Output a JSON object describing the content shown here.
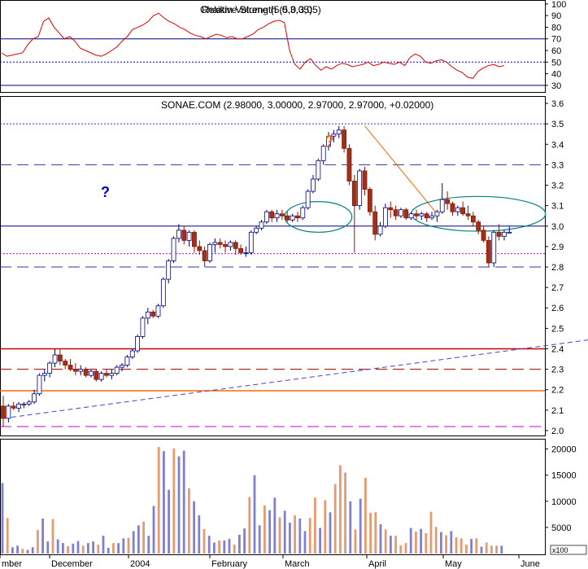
{
  "chart_data": [
    {
      "panel": "rsi",
      "type": "line",
      "title": "Relative Strength (5,0.3,05)",
      "title_overlay": "Chaikin Volume (5,0.3,05)",
      "y_ticks": [
        30,
        40,
        50,
        60,
        70,
        80,
        90,
        100
      ],
      "ylim": [
        25,
        102
      ],
      "reference_lines": [
        {
          "value": 70,
          "style": "solid",
          "color": "#000080"
        },
        {
          "value": 50,
          "style": "dotted",
          "color": "#0000cc"
        },
        {
          "value": 30,
          "style": "solid",
          "color": "#000080"
        }
      ],
      "series": [
        {
          "color": "#dd0000",
          "values": [
            58,
            55,
            56,
            57,
            58,
            65,
            70,
            72,
            85,
            88,
            80,
            75,
            70,
            72,
            68,
            62,
            60,
            58,
            56,
            55,
            57,
            60,
            63,
            68,
            72,
            78,
            80,
            82,
            85,
            90,
            92,
            88,
            85,
            83,
            80,
            78,
            75,
            73,
            72,
            70,
            72,
            74,
            73,
            71,
            72,
            70,
            70,
            72,
            74,
            78,
            80,
            83,
            85,
            86,
            84,
            60,
            48,
            44,
            50,
            53,
            47,
            43,
            46,
            44,
            47,
            49,
            48,
            46,
            47,
            48,
            50,
            47,
            48,
            50,
            49,
            48,
            50,
            47,
            54,
            57,
            55,
            50,
            49,
            51,
            52,
            50,
            46,
            43,
            41,
            37,
            36,
            42,
            45,
            47,
            48,
            46,
            47
          ]
        }
      ]
    },
    {
      "panel": "price",
      "type": "candlestick",
      "title": "SONAE.COM (2.98000, 3.00000, 2.97000, 2.97000, +0.02000)",
      "y_ticks": [
        2.0,
        2.1,
        2.2,
        2.3,
        2.4,
        2.5,
        2.6,
        2.7,
        2.8,
        2.9,
        3.0,
        3.1,
        3.2,
        3.3,
        3.4,
        3.5,
        3.6
      ],
      "ylim": [
        1.98,
        3.62
      ],
      "x_labels": [
        "mber",
        "December",
        "2004",
        "February",
        "March",
        "April",
        "May",
        "June"
      ],
      "annotations": [
        {
          "text": "?",
          "color": "#0000cc"
        },
        {
          "text": "?",
          "color": "#ff6600"
        }
      ],
      "horizontal_lines": [
        {
          "value": 3.5,
          "style": "dotted",
          "color": "#3333cc"
        },
        {
          "value": 3.3,
          "style": "dashed",
          "color": "#3333aa"
        },
        {
          "value": 3.0,
          "style": "solid",
          "color": "#000080"
        },
        {
          "value": 2.865,
          "style": "dotted",
          "color": "#cc00cc"
        },
        {
          "value": 2.8,
          "style": "dashed",
          "color": "#3333aa"
        },
        {
          "value": 2.4,
          "style": "solid",
          "color": "#cc0000"
        },
        {
          "value": 2.3,
          "style": "dashed",
          "color": "#990000"
        },
        {
          "value": 2.195,
          "style": "solid",
          "color": "#ff6600"
        },
        {
          "value": 2.02,
          "style": "dashed",
          "color": "#cc00cc"
        }
      ],
      "trendlines": [
        {
          "from": [
            0,
            2.06
          ],
          "to": [
            130,
            2.5
          ],
          "color": "#4444cc",
          "style": "dashed"
        },
        {
          "from": [
            70,
            3.49
          ],
          "to": [
            84,
            3.06
          ],
          "color": "#ff6600",
          "style": "solid"
        }
      ],
      "ellipses": [
        {
          "center": [
            61,
            3.045
          ],
          "rx_bars": 6.5,
          "ry": 0.075,
          "color": "#008080"
        },
        {
          "center": [
            92,
            3.06
          ],
          "rx_bars": 13,
          "ry": 0.085,
          "color": "#008080"
        }
      ],
      "series": [
        {
          "name": "SONAE.COM",
          "ohlc": [
            [
              2.12,
              2.17,
              2.02,
              2.06
            ],
            [
              2.06,
              2.13,
              2.04,
              2.12
            ],
            [
              2.12,
              2.14,
              2.1,
              2.11
            ],
            [
              2.11,
              2.14,
              2.09,
              2.13
            ],
            [
              2.13,
              2.14,
              2.11,
              2.13
            ],
            [
              2.13,
              2.15,
              2.12,
              2.14
            ],
            [
              2.14,
              2.2,
              2.13,
              2.18
            ],
            [
              2.18,
              2.28,
              2.17,
              2.27
            ],
            [
              2.27,
              2.3,
              2.24,
              2.28
            ],
            [
              2.28,
              2.34,
              2.26,
              2.33
            ],
            [
              2.33,
              2.4,
              2.31,
              2.37
            ],
            [
              2.37,
              2.4,
              2.32,
              2.34
            ],
            [
              2.34,
              2.35,
              2.3,
              2.32
            ],
            [
              2.32,
              2.35,
              2.29,
              2.3
            ],
            [
              2.3,
              2.33,
              2.27,
              2.29
            ],
            [
              2.29,
              2.32,
              2.27,
              2.3
            ],
            [
              2.3,
              2.31,
              2.26,
              2.27
            ],
            [
              2.27,
              2.3,
              2.26,
              2.29
            ],
            [
              2.29,
              2.3,
              2.24,
              2.25
            ],
            [
              2.25,
              2.29,
              2.24,
              2.28
            ],
            [
              2.28,
              2.3,
              2.26,
              2.27
            ],
            [
              2.27,
              2.3,
              2.25,
              2.28
            ],
            [
              2.28,
              2.32,
              2.27,
              2.31
            ],
            [
              2.31,
              2.33,
              2.29,
              2.32
            ],
            [
              2.32,
              2.37,
              2.31,
              2.36
            ],
            [
              2.36,
              2.4,
              2.35,
              2.39
            ],
            [
              2.39,
              2.47,
              2.38,
              2.46
            ],
            [
              2.46,
              2.56,
              2.45,
              2.55
            ],
            [
              2.55,
              2.6,
              2.52,
              2.58
            ],
            [
              2.58,
              2.59,
              2.55,
              2.56
            ],
            [
              2.56,
              2.62,
              2.55,
              2.61
            ],
            [
              2.61,
              2.75,
              2.6,
              2.74
            ],
            [
              2.74,
              2.84,
              2.72,
              2.83
            ],
            [
              2.83,
              2.95,
              2.82,
              2.94
            ],
            [
              2.94,
              3.01,
              2.92,
              2.98
            ],
            [
              2.98,
              3.0,
              2.91,
              2.93
            ],
            [
              2.93,
              2.98,
              2.9,
              2.97
            ],
            [
              2.97,
              2.98,
              2.87,
              2.9
            ],
            [
              2.9,
              2.93,
              2.86,
              2.88
            ],
            [
              2.88,
              2.9,
              2.8,
              2.83
            ],
            [
              2.83,
              2.92,
              2.82,
              2.91
            ],
            [
              2.91,
              2.94,
              2.87,
              2.92
            ],
            [
              2.92,
              2.94,
              2.89,
              2.91
            ],
            [
              2.91,
              2.93,
              2.87,
              2.9
            ],
            [
              2.9,
              2.93,
              2.88,
              2.92
            ],
            [
              2.92,
              2.93,
              2.86,
              2.89
            ],
            [
              2.89,
              2.91,
              2.86,
              2.87
            ],
            [
              2.87,
              2.9,
              2.85,
              2.87
            ],
            [
              2.87,
              2.98,
              2.86,
              2.97
            ],
            [
              2.97,
              3.0,
              2.96,
              2.99
            ],
            [
              2.99,
              3.03,
              2.98,
              3.02
            ],
            [
              3.02,
              3.08,
              3.01,
              3.07
            ],
            [
              3.07,
              3.08,
              3.02,
              3.04
            ],
            [
              3.04,
              3.08,
              3.02,
              3.06
            ],
            [
              3.06,
              3.08,
              3.03,
              3.05
            ],
            [
              3.05,
              3.07,
              3.02,
              3.03
            ],
            [
              3.03,
              3.06,
              3.02,
              3.05
            ],
            [
              3.05,
              3.07,
              3.02,
              3.04
            ],
            [
              3.04,
              3.1,
              3.03,
              3.09
            ],
            [
              3.09,
              3.18,
              3.08,
              3.17
            ],
            [
              3.17,
              3.25,
              3.16,
              3.23
            ],
            [
              3.23,
              3.33,
              3.22,
              3.32
            ],
            [
              3.32,
              3.4,
              3.3,
              3.39
            ],
            [
              3.39,
              3.46,
              3.37,
              3.44
            ],
            [
              3.44,
              3.47,
              3.41,
              3.45
            ],
            [
              3.45,
              3.49,
              3.43,
              3.47
            ],
            [
              3.47,
              3.49,
              3.36,
              3.38
            ],
            [
              3.38,
              3.4,
              3.2,
              3.22
            ],
            [
              3.22,
              3.25,
              2.87,
              3.1
            ],
            [
              3.1,
              3.28,
              3.08,
              3.27
            ],
            [
              3.27,
              3.29,
              3.15,
              3.18
            ],
            [
              3.18,
              3.19,
              3.05,
              3.07
            ],
            [
              3.07,
              3.1,
              2.93,
              2.96
            ],
            [
              2.96,
              3.02,
              2.95,
              3.0
            ],
            [
              3.0,
              3.11,
              2.99,
              3.09
            ],
            [
              3.09,
              3.12,
              3.04,
              3.08
            ],
            [
              3.08,
              3.1,
              3.03,
              3.05
            ],
            [
              3.05,
              3.09,
              3.04,
              3.08
            ],
            [
              3.08,
              3.09,
              3.03,
              3.04
            ],
            [
              3.04,
              3.07,
              3.03,
              3.06
            ],
            [
              3.06,
              3.08,
              3.03,
              3.05
            ],
            [
              3.05,
              3.07,
              3.03,
              3.06
            ],
            [
              3.06,
              3.07,
              3.02,
              3.04
            ],
            [
              3.04,
              3.07,
              3.03,
              3.05
            ],
            [
              3.05,
              3.08,
              3.02,
              3.07
            ],
            [
              3.07,
              3.21,
              3.06,
              3.13
            ],
            [
              3.13,
              3.17,
              3.08,
              3.11
            ],
            [
              3.11,
              3.12,
              3.05,
              3.07
            ],
            [
              3.07,
              3.1,
              3.05,
              3.09
            ],
            [
              3.09,
              3.12,
              3.05,
              3.06
            ],
            [
              3.06,
              3.1,
              3.03,
              3.05
            ],
            [
              3.05,
              3.07,
              3.0,
              3.02
            ],
            [
              3.02,
              3.03,
              2.96,
              2.98
            ],
            [
              2.98,
              3.0,
              2.92,
              2.93
            ],
            [
              2.93,
              2.95,
              2.8,
              2.82
            ],
            [
              2.82,
              2.98,
              2.8,
              2.97
            ],
            [
              2.97,
              3.01,
              2.93,
              2.95
            ],
            [
              2.95,
              2.98,
              2.93,
              2.97
            ],
            [
              2.97,
              3.0,
              2.97,
              2.97
            ]
          ]
        }
      ]
    },
    {
      "panel": "volume",
      "type": "bar",
      "y_ticks": [
        5000,
        10000,
        15000,
        20000
      ],
      "ylim": [
        0,
        21500
      ],
      "unit_label": "x100",
      "values": [
        13500,
        6800,
        1200,
        1500,
        900,
        700,
        1200,
        4500,
        6700,
        2300,
        6600,
        2700,
        2000,
        1400,
        1900,
        2400,
        1500,
        2000,
        2300,
        1700,
        3400,
        1100,
        2000,
        2000,
        2900,
        3000,
        4300,
        5400,
        6100,
        3400,
        9100,
        20400,
        19600,
        12200,
        20100,
        18600,
        19700,
        12500,
        10000,
        7300,
        4700,
        3400,
        2100,
        2500,
        2500,
        2800,
        1700,
        3600,
        4800,
        10800,
        15000,
        5400,
        9200,
        8300,
        10700,
        6900,
        8200,
        5900,
        7300,
        6700,
        4300,
        6800,
        10700,
        4900,
        10200,
        7900,
        13300,
        16900,
        15500,
        10000,
        4600,
        10500,
        14500,
        7800,
        7900,
        5600,
        4600,
        3400,
        3400,
        1600,
        2000,
        4900,
        4200,
        4700,
        3900,
        8000,
        5100,
        4100,
        3500,
        4300,
        3100,
        2900,
        1700,
        2800,
        2900,
        1300,
        2100,
        1500,
        1500,
        1500
      ]
    }
  ]
}
